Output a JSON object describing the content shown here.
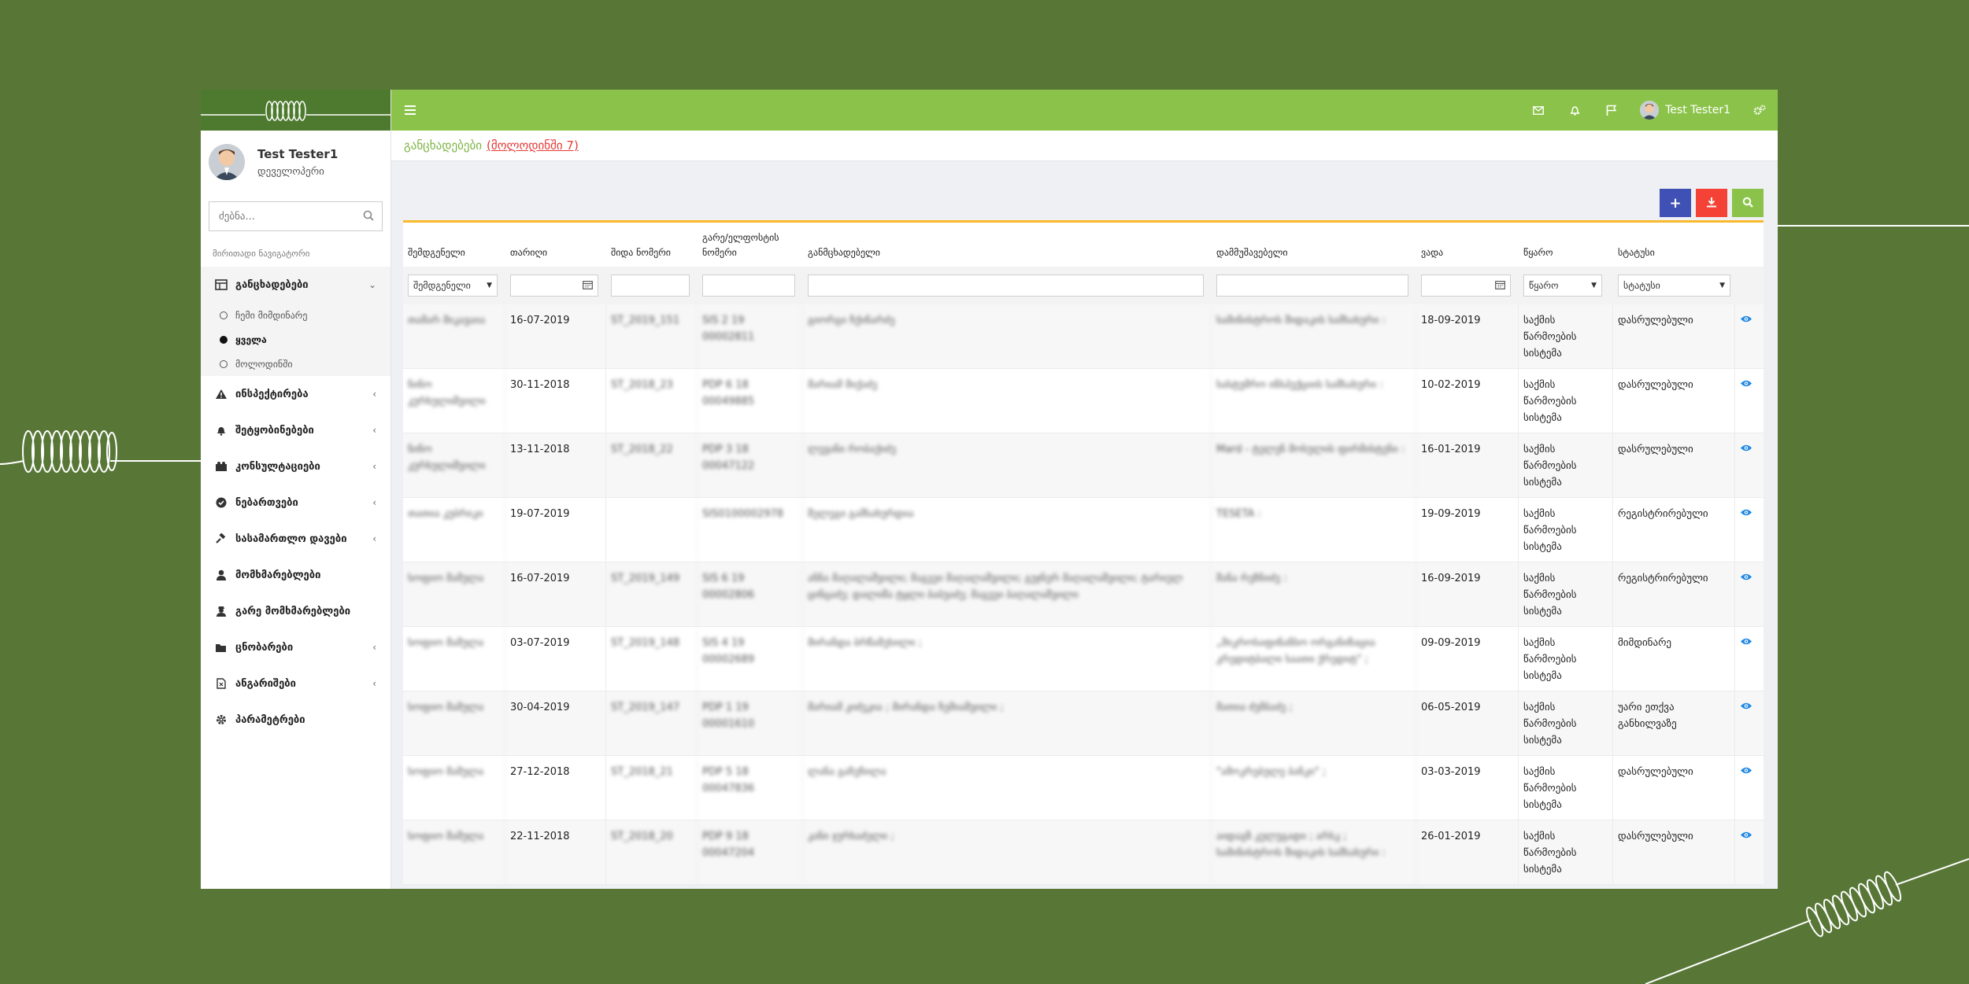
{
  "sidebar": {
    "user_name": "Test Tester1",
    "user_role": "დეველოპერი",
    "search_placeholder": "ძებნა...",
    "nav_header": "მირითადი ნავიგატორი",
    "items": [
      {
        "label": "განცხადებები",
        "icon": "list-icon",
        "expanded": true
      },
      {
        "label": "ინსპექტირება",
        "icon": "warning-icon"
      },
      {
        "label": "შეტყობინებები",
        "icon": "bell-icon"
      },
      {
        "label": "კონსულტაციები",
        "icon": "consult-icon"
      },
      {
        "label": "ნებართვები",
        "icon": "check-circle-icon"
      },
      {
        "label": "სასამართლო დავები",
        "icon": "gavel-icon"
      },
      {
        "label": "მომხმარებლები",
        "icon": "user-icon"
      },
      {
        "label": "გარე მომხმარებლები",
        "icon": "user-secret-icon"
      },
      {
        "label": "ცნობარები",
        "icon": "folder-icon"
      },
      {
        "label": "ანგარიშები",
        "icon": "report-icon"
      },
      {
        "label": "პარამეტრები",
        "icon": "gear-icon"
      }
    ],
    "subitems": [
      {
        "label": "ჩემი მიმდინარე"
      },
      {
        "label": "ყველა"
      },
      {
        "label": "მოლოდინში"
      }
    ]
  },
  "topbar": {
    "user_name": "Test Tester1",
    "icons": [
      "envelope-icon",
      "bell-icon",
      "flag-icon",
      "gears-icon"
    ]
  },
  "breadcrumb": {
    "title": "განცხადებები",
    "pending_link": "(მოლოდინში 7)"
  },
  "colors": {
    "background": "#587737",
    "topbar": "#8bc34a",
    "logo_bar": "#4d7a2e",
    "btn_add": "#3f51b5",
    "btn_download": "#f44336",
    "btn_search": "#8bc34a",
    "accent_line": "#f9b92b"
  },
  "table": {
    "headers": [
      "შემდგენელი",
      "თარიღი",
      "შიდა ნომერი",
      "გარე/ელფოსტის ნომერი",
      "განმცხადებელი",
      "დამმუშავებელი",
      "ვადა",
      "წყარო",
      "სტატუსი"
    ],
    "filters": {
      "author": "შემდგენელი",
      "source": "წყარო",
      "status": "სტატუსი"
    },
    "rows": [
      {
        "author": "თამარ მიკავაია",
        "date": "16-07-2019",
        "internal": "ST_2019_151",
        "external": "SIS 2 19 00002811",
        "applicant": "გიორგი ჩქინარძე",
        "processor": "სამინისტროს შიდაკის სამსახური :",
        "deadline": "18-09-2019",
        "source": "საქმის წარმოების სისტემა",
        "status": "დასრულებული"
      },
      {
        "author": "ნინო კურხულიშვილი",
        "date": "30-11-2018",
        "internal": "ST_2018_23",
        "external": "PDP 6 18 00049885",
        "applicant": "მარიამ მიქაძე",
        "processor": "სასტუმრო ინსპექციის სამსახური :",
        "deadline": "10-02-2019",
        "source": "საქმის წარმოების სისტემა",
        "status": "დასრულებული"
      },
      {
        "author": "ნინო კურხულიშვილი",
        "date": "13-11-2018",
        "internal": "ST_2018_22",
        "external": "PDP 3 18 00047122",
        "applicant": "ლევანი რობაქიძე",
        "processor": "Mard - ტელენ მოსულის ფირმისტენი :",
        "deadline": "16-01-2019",
        "source": "საქმის წარმოების სისტემა",
        "status": "დასრულებული"
      },
      {
        "author": "თათია კუბრიკი",
        "date": "19-07-2019",
        "internal": "",
        "external": "SIS0100002978",
        "applicant": "შელეგი გამსახურდია",
        "processor": "TESETA :",
        "deadline": "19-09-2019",
        "source": "საქმის წარმოების სისტემა",
        "status": "რეგისტრირებული"
      },
      {
        "author": "სოფიო მამულა",
        "date": "16-07-2019",
        "internal": "ST_2019_149",
        "external": "SIS 6 19 00002806",
        "applicant": "ანნა მაღალაშვილი; მაგეეი მაღალაშვილი; გუჯნერ მაღალაშვილი; ტარიელ ცინცაძე; დალიშა ტყლი ბაბუაძე; მაგეეი ბაღალაშვილი",
        "processor": "შანა რეზნიძე :",
        "deadline": "16-09-2019",
        "source": "საქმის წარმოების სისტემა",
        "status": "რეგისტრირებული"
      },
      {
        "author": "სოფიო მამულა",
        "date": "03-07-2019",
        "internal": "ST_2019_148",
        "external": "SIS 4 19 00002689",
        "applicant": "მირანდა ბრწამესილი ;",
        "processor": "„მიკროსაფინანსო ორგანიზაცია კრედიტბალი საათი ქრედიტ\" ;",
        "deadline": "09-09-2019",
        "source": "საქმის წარმოების სისტემა",
        "status": "მიმდინარე"
      },
      {
        "author": "სოფიო მამულა",
        "date": "30-04-2019",
        "internal": "ST_2019_147",
        "external": "PDP 1 19 00001610",
        "applicant": "მარიამ კიძეკია ; მირანდა ჩემიაშვილი ;",
        "processor": "მათია ძუმბაძე ;",
        "deadline": "06-05-2019",
        "source": "საქმის წარმოების სისტემა",
        "status": "უარი ეთქვა განხილვაზე"
      },
      {
        "author": "სოფიო მამულა",
        "date": "27-12-2018",
        "internal": "ST_2018_21",
        "external": "PDP 5 18 00047836",
        "applicant": "ლანა გაჩეჩილა",
        "processor": "\"ამოკრებულე ბანკი\" ;",
        "deadline": "03-03-2019",
        "source": "საქმის წარმოების სისტემა",
        "status": "დასრულებული"
      },
      {
        "author": "სოფიო მამულა",
        "date": "22-11-2018",
        "internal": "ST_2018_20",
        "external": "PDP 9 18 00047204",
        "applicant": "კანი ჯურხაძელი ;",
        "processor": "აიდაგზ კელუგადი ; არსკ ; სამინისტროს შიდაკის სამსახური :",
        "deadline": "26-01-2019",
        "source": "საქმის წარმოების სისტემა",
        "status": "დასრულებული"
      }
    ]
  }
}
